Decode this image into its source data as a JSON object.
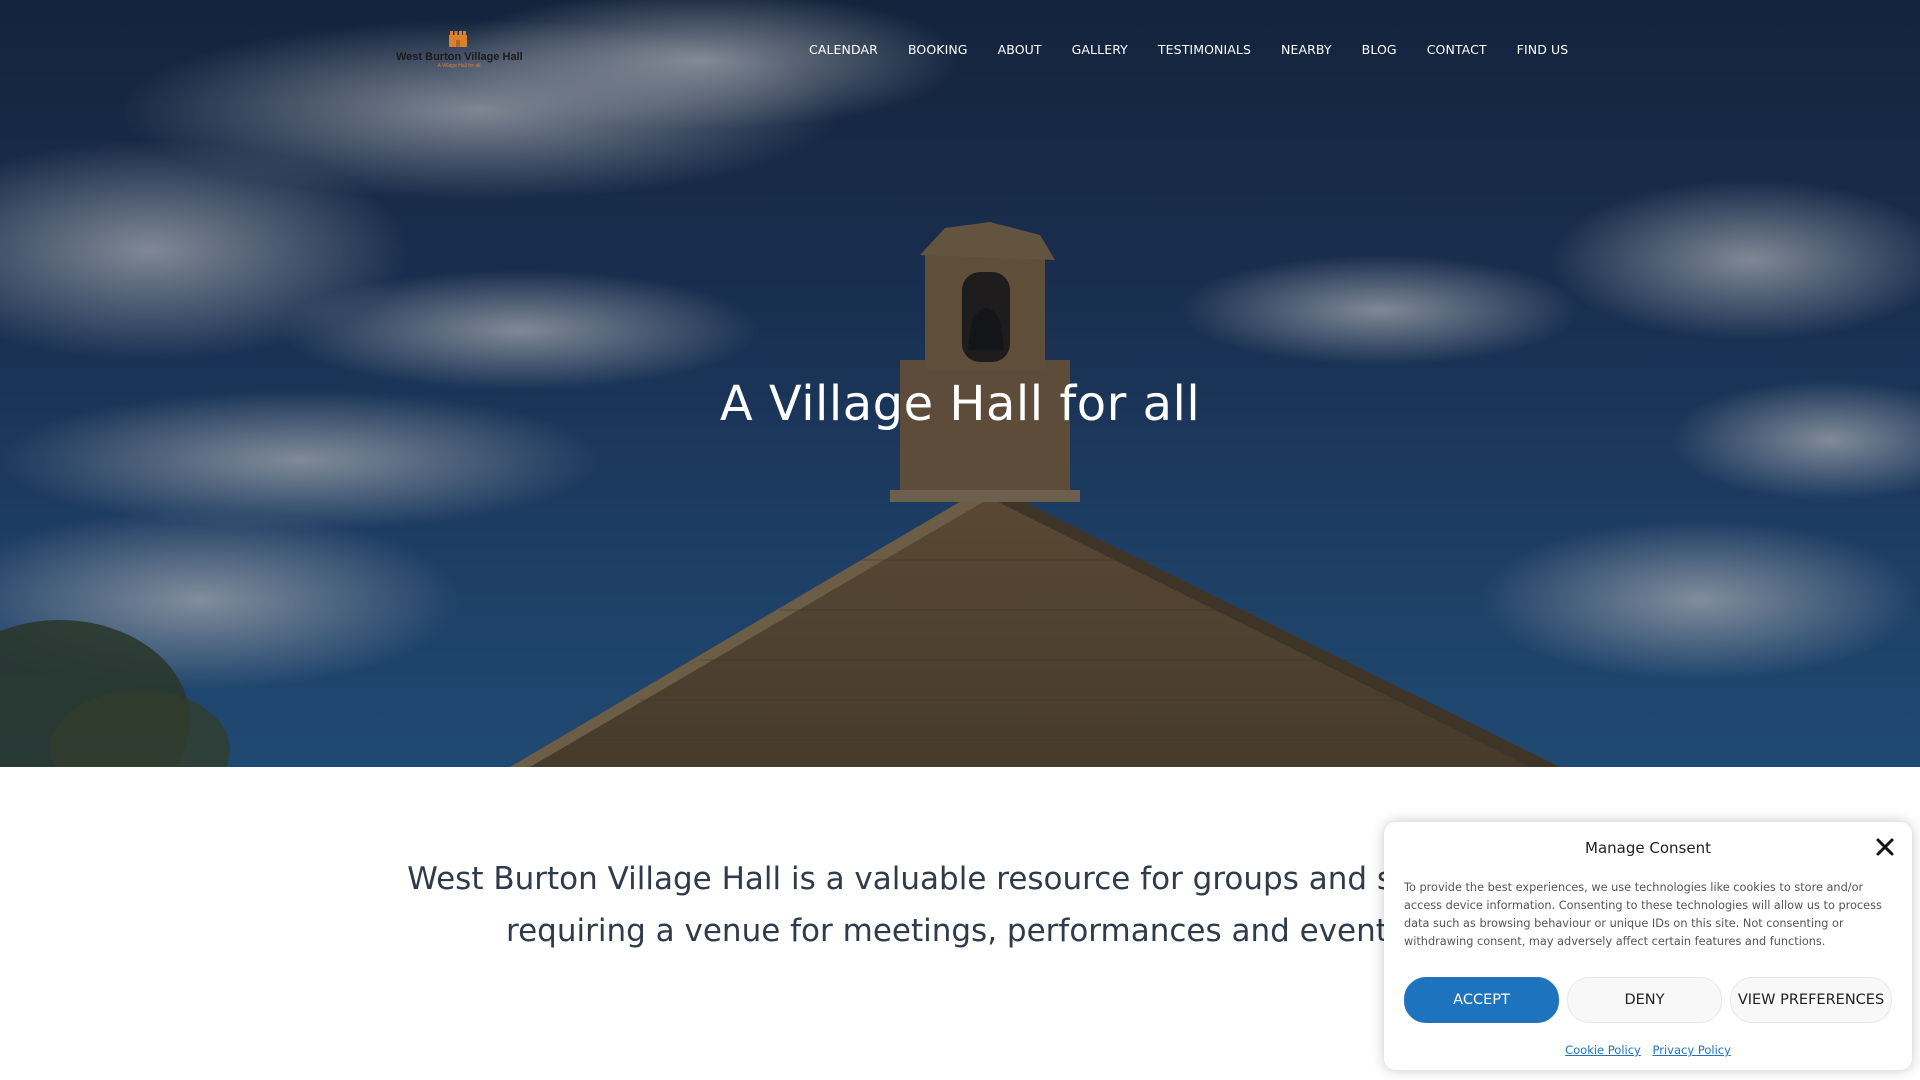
{
  "site": {
    "logo_name": "West Burton Village Hall",
    "logo_tagline": "A Village Hall for all",
    "logo_icon": "hall-building-icon"
  },
  "nav": {
    "items": [
      {
        "label": "CALENDAR"
      },
      {
        "label": "BOOKING"
      },
      {
        "label": "ABOUT"
      },
      {
        "label": "GALLERY"
      },
      {
        "label": "TESTIMONIALS"
      },
      {
        "label": "NEARBY"
      },
      {
        "label": "BLOG"
      },
      {
        "label": "CONTACT"
      },
      {
        "label": "FIND US"
      }
    ]
  },
  "hero": {
    "title": "A Village Hall for all"
  },
  "intro": {
    "line1": "West Burton Village Hall is a valuable resource for groups and societies",
    "line2": "requiring a venue for meetings, performances and events."
  },
  "consent": {
    "title": "Manage Consent",
    "body": "To provide the best experiences, we use technologies like cookies to store and/or access device information. Consenting to these technologies will allow us to process data such as browsing behaviour or unique IDs on this site. Not consenting or withdrawing consent, may adversely affect certain features and functions.",
    "accept_label": "ACCEPT",
    "deny_label": "DENY",
    "preferences_label": "VIEW PREFERENCES",
    "cookie_policy_label": "Cookie Policy",
    "privacy_policy_label": "Privacy Policy",
    "close_icon": "close-icon"
  },
  "colors": {
    "accent": "#1e73be",
    "text": "#2f3b4a",
    "logo_orange": "#d9822b"
  }
}
